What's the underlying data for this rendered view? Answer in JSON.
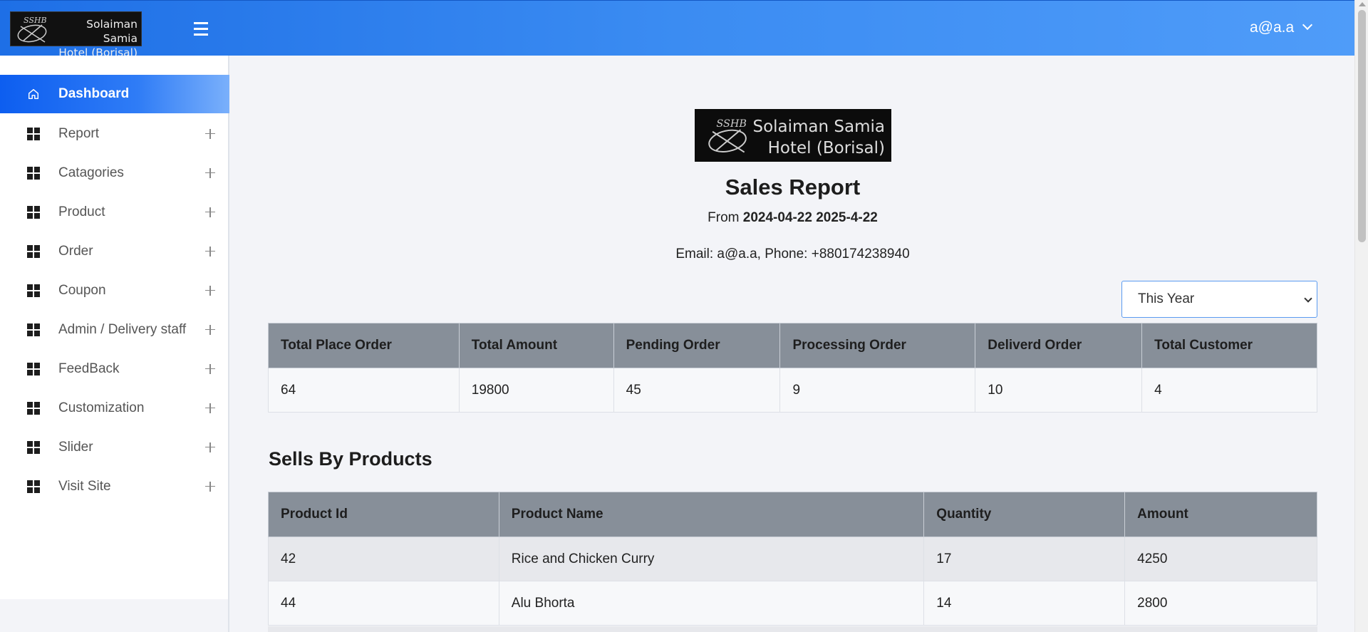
{
  "header": {
    "brand_line1": "Solaiman Samia",
    "brand_line2": "Hotel (Borisal)",
    "menu_icon": "hamburger-icon",
    "user_email": "a@a.a"
  },
  "sidebar": {
    "items": [
      {
        "label": "Dashboard",
        "icon": "home-icon",
        "active": true
      },
      {
        "label": "Report",
        "icon": "grid-icon"
      },
      {
        "label": "Catagories",
        "icon": "grid-icon"
      },
      {
        "label": "Product",
        "icon": "grid-icon"
      },
      {
        "label": "Order",
        "icon": "grid-icon"
      },
      {
        "label": "Coupon",
        "icon": "grid-icon"
      },
      {
        "label": "Admin / Delivery staff",
        "icon": "grid-icon"
      },
      {
        "label": "FeedBack",
        "icon": "grid-icon"
      },
      {
        "label": "Customization",
        "icon": "grid-icon"
      },
      {
        "label": "Slider",
        "icon": "grid-icon"
      },
      {
        "label": "Visit Site",
        "icon": "grid-icon"
      }
    ]
  },
  "report": {
    "logo_line1": "Solaiman Samia",
    "logo_line2": "Hotel (Borisal)",
    "title": "Sales Report",
    "from_label": "From",
    "date_start": "2024-04-22",
    "date_end": "2025-4-22",
    "contact": "Email: a@a.a, Phone: +880174238940",
    "period_selected": "This Year"
  },
  "summary": {
    "headers": [
      "Total Place Order",
      "Total Amount",
      "Pending Order",
      "Processing Order",
      "Deliverd Order",
      "Total Customer"
    ],
    "values": [
      "64",
      "19800",
      "45",
      "9",
      "10",
      "4"
    ]
  },
  "products": {
    "section_title": "Sells By Products",
    "headers": [
      "Product Id",
      "Product Name",
      "Quantity",
      "Amount"
    ],
    "rows": [
      [
        "42",
        "Rice and Chicken Curry",
        "17",
        "4250"
      ],
      [
        "44",
        "Alu Bhorta",
        "14",
        "2800"
      ]
    ]
  },
  "colors": {
    "header_gradient_start": "#1e6fe6",
    "header_gradient_end": "#4f9cf9",
    "active_nav": "#0d5ef0",
    "table_header": "#878f99"
  }
}
